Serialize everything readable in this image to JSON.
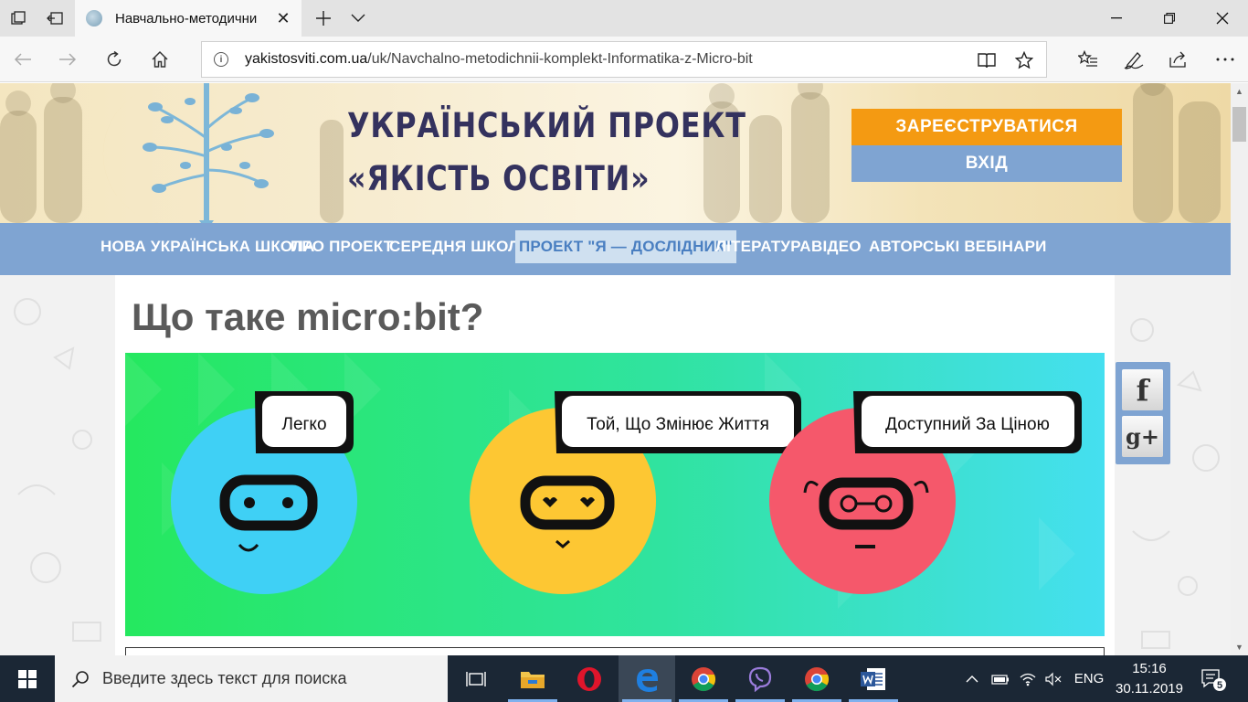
{
  "browser": {
    "tab_title": "Навчально-методични",
    "url_host": "yakistosviti.com.ua",
    "url_path": "/uk/Navchalno-metodichnii-komplekt-Informatika-z-Micro-bit"
  },
  "site": {
    "title_line1": "УКРАЇНСЬКИЙ ПРОЕКТ",
    "title_line2": "«ЯКІСТЬ ОСВІТИ»",
    "register_label": "ЗАРЕЄСТРУВАТИСЯ",
    "login_label": "ВХІД",
    "nav": [
      {
        "label": "НОВА УКРАЇНСЬКА ШКОЛА",
        "active": false
      },
      {
        "label": "ПРО ПРОЕКТ",
        "active": false
      },
      {
        "label": "СЕРЕДНЯ ШКОЛА",
        "active": false
      },
      {
        "label": "ПРОЕКТ \"Я — ДОСЛІДНИК\"",
        "active": true
      },
      {
        "label": "ЛІТЕРАТУРА",
        "active": false
      },
      {
        "label": "ВІДЕО",
        "active": false
      },
      {
        "label": "АВТОРСЬКІ ВЕБІНАРИ",
        "active": false
      }
    ]
  },
  "article": {
    "title": "Що таке micro:bit?",
    "hero_bubbles": [
      "Легко",
      "Той, Що Змінює Життя",
      "Доступний За Ціною"
    ]
  },
  "social": {
    "facebook_label": "f",
    "google_label": "g+"
  },
  "taskbar": {
    "search_placeholder": "Введите здесь текст для поиска",
    "language": "ENG",
    "time": "15:16",
    "date": "30.11.2019",
    "notification_count": "5"
  },
  "colors": {
    "nav_blue": "#7fa4d2",
    "register_orange": "#f49a12",
    "title_navy": "#34325e",
    "robot_blue": "#3fd0f5",
    "robot_yellow": "#fdc733",
    "robot_red": "#f5586b"
  }
}
